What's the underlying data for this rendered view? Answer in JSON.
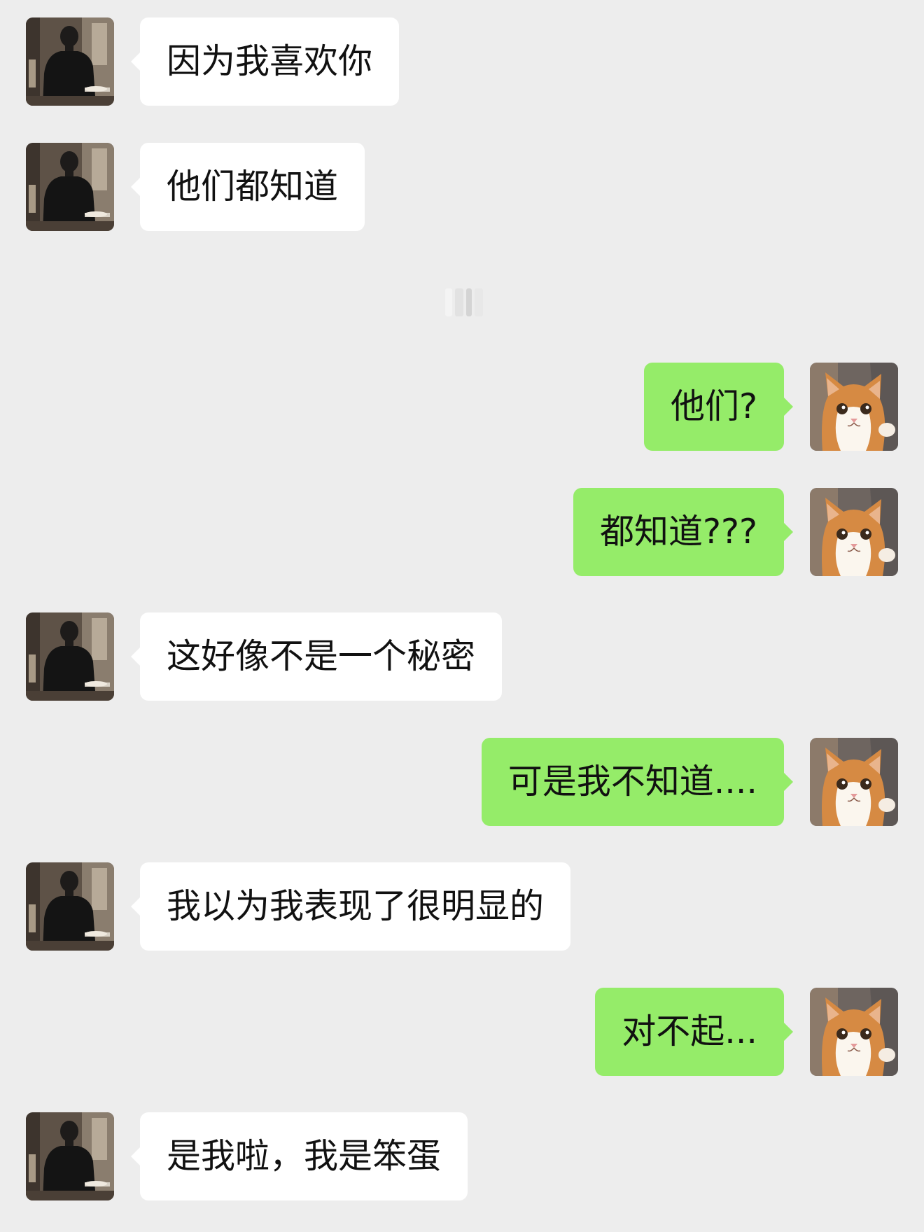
{
  "conversation": {
    "messages": [
      {
        "side": "left",
        "text": "因为我喜欢你"
      },
      {
        "side": "left",
        "text": "他们都知道"
      },
      {
        "side": "right",
        "text": "他们?"
      },
      {
        "side": "right",
        "text": "都知道???"
      },
      {
        "side": "left",
        "text": "这好像不是一个秘密"
      },
      {
        "side": "right",
        "text": "可是我不知道...."
      },
      {
        "side": "left",
        "text": "我以为我表现了很明显的"
      },
      {
        "side": "right",
        "text": "对不起..."
      },
      {
        "side": "left",
        "text": "是我啦，我是笨蛋"
      }
    ]
  },
  "colors": {
    "background": "#ededed",
    "incoming_bubble": "#ffffff",
    "outgoing_bubble": "#95ec69",
    "text": "#111111"
  },
  "icons": {
    "contact_avatar": "person-photo-avatar",
    "self_avatar": "orange-cat-avatar"
  }
}
